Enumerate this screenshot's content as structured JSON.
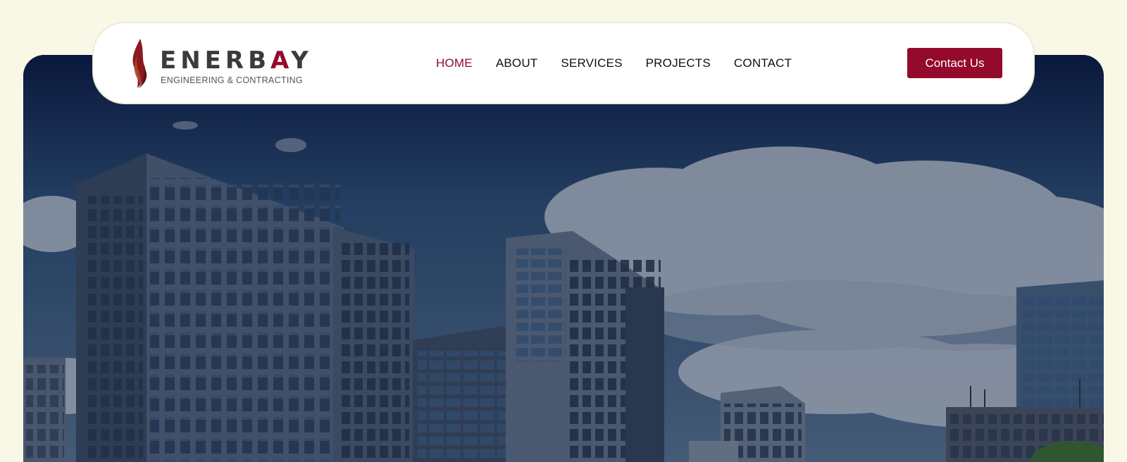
{
  "brand": {
    "name": "ENERBAY",
    "tagline": "ENGINEERING & CONTRACTING",
    "accent": "#930a2c",
    "text_color": "#3b3b3b"
  },
  "nav": {
    "items": [
      {
        "label": "HOME",
        "active": true
      },
      {
        "label": "ABOUT",
        "active": false
      },
      {
        "label": "SERVICES",
        "active": false
      },
      {
        "label": "PROJECTS",
        "active": false
      },
      {
        "label": "CONTACT",
        "active": false
      }
    ]
  },
  "header": {
    "cta_label": "Contact Us"
  },
  "hero": {
    "image_subject": "city-buildings-sky-photo"
  },
  "colors": {
    "page_bg": "#f9f8e6",
    "header_bg": "#ffffff",
    "active_nav": "#8b0f2a"
  }
}
